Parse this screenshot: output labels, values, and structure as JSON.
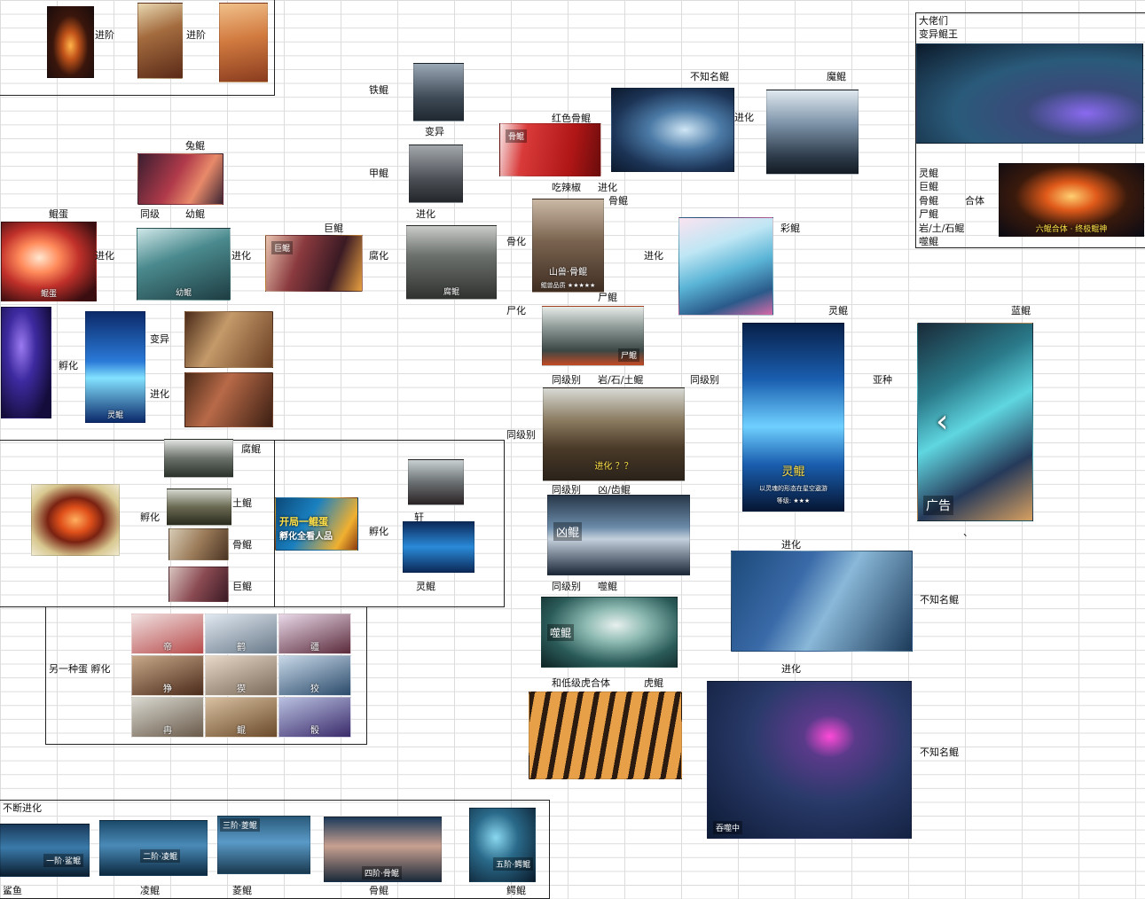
{
  "labels": {
    "advance1": "进阶",
    "advance2": "进阶",
    "tie_kun": "铁鲲",
    "bian_yi": "变异",
    "jia_kun": "甲鲲",
    "jin_hua_mid": "进化",
    "hong_se_gu_kun": "红色骨鲲",
    "la_jiao": "吃辣椒",
    "jin_hua_la": "进化",
    "gu_kun_top": "骨鲲",
    "bu_zhi_ming_kun": "不知名鲲",
    "mo_kun": "魔鲲",
    "jin_hua_whale": "进化",
    "tu_kun": "兔鲲",
    "tong_ji_1": "同级",
    "you_kun": "幼鲲",
    "kun_dan": "鲲蛋",
    "jin_hua_egg": "进化",
    "jin_hua_young": "进化",
    "ju_kun": "巨鲲",
    "fu_hua_rot": "腐化",
    "gu_hua": "骨化",
    "jin_hua_gu": "进化",
    "cai_kun": "彩鲲",
    "shi_kun": "尸鲲",
    "shi_hua": "尸化",
    "ling_kun_right": "灵鲲",
    "lan_kun": "蓝鲲",
    "fu_hua_hatch": "孵化",
    "bian_yi_2": "变异",
    "jin_hua_spirit": "进化",
    "tong_ji_bie_1": "同级别",
    "yan_shi_tu": "岩/石/土鲲",
    "tong_ji_bie_2": "同级别",
    "ya_zhong": "亚种",
    "tong_ji_bie_3": "同级别",
    "tong_ji_bie_4": "同级别",
    "xiong_chi": "凶/齿鲲",
    "tong_ji_bie_5": "同级别",
    "shi_kun_2": "噬鲲",
    "he_di_ji": "和低级虎合体",
    "hu_kun": "虎鲲",
    "fu_kun_box": "腐鲲",
    "tu_kun_box": "土鲲",
    "gu_kun_box": "骨鲲",
    "ju_kun_box": "巨鲲",
    "fu_hua_box": "孵化",
    "fu_hua_box2": "孵化",
    "xuan": "轩",
    "ling_kun_box": "灵鲲",
    "ling_yi_zhong": "另一种蛋 孵化",
    "jin_hua_r1": "进化",
    "bu_zhi_ming_r1": "不知名鲲",
    "jin_hua_r2": "进化",
    "bu_zhi_ming_r2": "不知名鲲",
    "bu_duan": "不断进化",
    "sha_yu": "鲨鱼",
    "ling_kun_bottom": "凌鲲",
    "ling_kun_b2": "菱鲲",
    "gu_kun_bottom": "骨鲲",
    "e_kun": "鳄鲲",
    "dot": "、"
  },
  "topright": {
    "line1": "大佬们",
    "line2": "变异鲲王",
    "list": [
      "灵鲲",
      "巨鲲",
      "骨鲲",
      "尸鲲",
      "岩/土/石鲲",
      "噬鲲"
    ],
    "he_ti": "合体",
    "fusion_caption": "六鲲合体 · 终极鲲神"
  },
  "overlays": {
    "kun_dan": "鲲蛋",
    "you_kun": "幼鲲",
    "ju": "巨鲲",
    "fu_kun": "腐鲲",
    "gu_kun_card": "山兽·骨鲲",
    "gu_kun_stars": "鲲兽品质 ★★★★★",
    "shi": "尸鲲",
    "ling": "灵鲲",
    "ling_big": "灵鲲",
    "ling_big_sub": "以灵魂的形态在星空遨游",
    "ling_big_stars": "等级: ★★★",
    "xiong": "凶鲲",
    "shi2": "噬鲲",
    "kai_ju": "开局一鲲蛋",
    "kai_ju2": "孵化全看人品",
    "shi_zhong": "吞噬中",
    "guang_gao": "广告",
    "jin_hua_tag": "进化 ？？",
    "hong_gu_tag": "骨鲲",
    "s1": "一阶·鲨鲲",
    "s2": "二阶·凌鲲",
    "s3": "三阶·菱鲲",
    "s4": "四阶·骨鲲",
    "s5": "五阶·鳄鲲"
  },
  "grid9": [
    "帝",
    "鹤",
    "疆",
    "狰",
    "猰",
    "狡",
    "冉",
    "鲲",
    "骰"
  ],
  "colors": {
    "line": "#222222",
    "grid": "#dcdcdc"
  }
}
